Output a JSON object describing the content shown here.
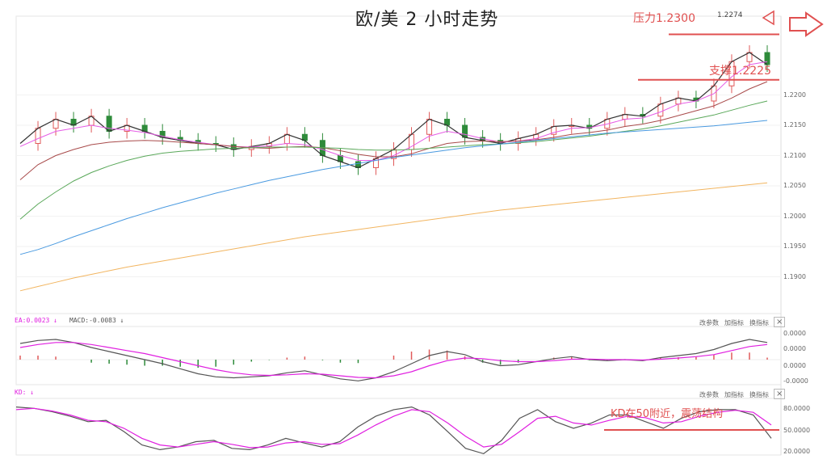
{
  "title": "欧/美 2 小时走势",
  "annotations": {
    "resistance": "压力1.2300",
    "support": "支撑1.2225",
    "kd_note": "KD在50附近，震荡结构"
  },
  "peak_label": "1.2274",
  "panel_buttons": [
    "改参数",
    "加指标",
    "换指标"
  ],
  "close_symbol": "×",
  "macd_legend": {
    "dea": "EA:0.0023 ↓",
    "macd": "MACD:-0.0083 ↓"
  },
  "kd_legend": "KD: ↓",
  "colors": {
    "up": "#e05a5a",
    "down": "#2e8b3a",
    "ma5": "#333333",
    "ma10": "#e65ce6",
    "ma20": "#c7a0a0",
    "ma30": "#a84a4a",
    "ma60": "#5aa85a",
    "ma120": "#4a9ae0",
    "ma250": "#f2b560",
    "annotation": "#e05050"
  },
  "chart_data": [
    {
      "type": "line",
      "panel": "price",
      "y_ticks": [
        "1.2200",
        "1.2150",
        "1.2100",
        "1.2050",
        "1.2000",
        "1.1950",
        "1.1900"
      ],
      "ylim": [
        1.185,
        1.233
      ],
      "series": [
        {
          "role": "price",
          "values": [
            1.212,
            1.2145,
            1.216,
            1.215,
            1.2165,
            1.214,
            1.215,
            1.214,
            1.213,
            1.2125,
            1.212,
            1.2118,
            1.211,
            1.2115,
            1.212,
            1.2135,
            1.2125,
            1.21,
            1.209,
            1.208,
            1.2095,
            1.211,
            1.2135,
            1.216,
            1.215,
            1.213,
            1.2125,
            1.212,
            1.2128,
            1.2135,
            1.2148,
            1.215,
            1.2145,
            1.216,
            1.2168,
            1.2165,
            1.2185,
            1.2195,
            1.219,
            1.2215,
            1.2255,
            1.227,
            1.225
          ]
        },
        {
          "role": "ma-short",
          "values": [
            1.2115,
            1.2128,
            1.214,
            1.2145,
            1.215,
            1.2145,
            1.2142,
            1.2138,
            1.2132,
            1.2126,
            1.2122,
            1.2118,
            1.2115,
            1.2114,
            1.2116,
            1.212,
            1.2118,
            1.211,
            1.21,
            1.2092,
            1.2092,
            1.21,
            1.2115,
            1.2132,
            1.214,
            1.2135,
            1.2128,
            1.2122,
            1.2124,
            1.2128,
            1.2138,
            1.2145,
            1.2146,
            1.2152,
            1.216,
            1.2162,
            1.2172,
            1.2185,
            1.219,
            1.2202,
            1.223,
            1.225,
            1.2255
          ]
        },
        {
          "role": "ma-mid",
          "values": [
            1.206,
            1.2085,
            1.21,
            1.211,
            1.2118,
            1.2122,
            1.2124,
            1.2125,
            1.2124,
            1.2122,
            1.212,
            1.2118,
            1.2115,
            1.2113,
            1.2112,
            1.2114,
            1.2115,
            1.2113,
            1.2108,
            1.2102,
            1.2098,
            1.2098,
            1.2103,
            1.2112,
            1.212,
            1.2123,
            1.2124,
            1.2123,
            1.2124,
            1.2126,
            1.213,
            1.2135,
            1.2138,
            1.2142,
            1.2148,
            1.2152,
            1.2158,
            1.2166,
            1.2174,
            1.2182,
            1.2195,
            1.221,
            1.2222
          ]
        },
        {
          "role": "ma-long",
          "values": [
            1.1995,
            1.202,
            1.204,
            1.2058,
            1.2072,
            1.2083,
            1.2092,
            1.2099,
            1.2104,
            1.2107,
            1.2109,
            1.2111,
            1.2112,
            1.2113,
            1.2114,
            1.2114,
            1.2114,
            1.2113,
            1.2112,
            1.211,
            1.2109,
            1.2109,
            1.211,
            1.2112,
            1.2114,
            1.2116,
            1.2118,
            1.2119,
            1.2121,
            1.2123,
            1.2126,
            1.2129,
            1.2132,
            1.2136,
            1.214,
            1.2144,
            1.2149,
            1.2155,
            1.2161,
            1.2167,
            1.2175,
            1.2183,
            1.219
          ]
        },
        {
          "role": "ma-120",
          "values": [
            1.1937,
            1.1945,
            1.1955,
            1.1966,
            1.1976,
            1.1986,
            1.1996,
            1.2005,
            1.2014,
            1.2022,
            1.203,
            1.2038,
            1.2045,
            1.2052,
            1.2059,
            1.2065,
            1.2071,
            1.2077,
            1.2082,
            1.2087,
            1.2092,
            1.2097,
            1.2101,
            1.2105,
            1.2109,
            1.2113,
            1.2116,
            1.2119,
            1.2122,
            1.2125,
            1.2128,
            1.2131,
            1.2134,
            1.2137,
            1.2139,
            1.2141,
            1.2143,
            1.2145,
            1.2147,
            1.2149,
            1.2152,
            1.2155,
            1.2158
          ]
        },
        {
          "role": "ma-250",
          "values": [
            1.1877,
            1.1884,
            1.1891,
            1.1898,
            1.1904,
            1.191,
            1.1916,
            1.1921,
            1.1926,
            1.1931,
            1.1936,
            1.1941,
            1.1946,
            1.1951,
            1.1956,
            1.1961,
            1.1966,
            1.197,
            1.1974,
            1.1978,
            1.1982,
            1.1986,
            1.199,
            1.1994,
            1.1998,
            1.2002,
            1.2006,
            1.201,
            1.2013,
            1.2016,
            1.2019,
            1.2022,
            1.2025,
            1.2028,
            1.2031,
            1.2034,
            1.2037,
            1.204,
            1.2043,
            1.2046,
            1.2049,
            1.2052,
            1.2055
          ]
        }
      ],
      "levels": [
        {
          "role": "resistance",
          "value": 1.23
        },
        {
          "role": "support",
          "value": 1.2225
        }
      ]
    },
    {
      "type": "line",
      "panel": "macd",
      "y_ticks": [
        "0.0000",
        "0.0000",
        "0.0000",
        "-0.0000"
      ],
      "series": [
        {
          "role": "dif",
          "values": [
            0.8,
            0.95,
            1.0,
            0.85,
            0.6,
            0.4,
            0.2,
            0.0,
            -0.2,
            -0.45,
            -0.7,
            -0.85,
            -0.9,
            -0.85,
            -0.8,
            -0.65,
            -0.55,
            -0.75,
            -0.95,
            -1.05,
            -0.9,
            -0.6,
            -0.2,
            0.2,
            0.4,
            0.25,
            -0.1,
            -0.3,
            -0.25,
            -0.1,
            0.05,
            0.15,
            0.0,
            -0.05,
            0.0,
            -0.05,
            0.1,
            0.2,
            0.3,
            0.5,
            0.8,
            1.0,
            0.85
          ]
        },
        {
          "role": "dea",
          "values": [
            0.6,
            0.75,
            0.85,
            0.85,
            0.75,
            0.6,
            0.45,
            0.3,
            0.1,
            -0.1,
            -0.3,
            -0.5,
            -0.65,
            -0.75,
            -0.78,
            -0.75,
            -0.7,
            -0.72,
            -0.8,
            -0.88,
            -0.9,
            -0.8,
            -0.6,
            -0.3,
            -0.05,
            0.08,
            0.05,
            -0.05,
            -0.1,
            -0.1,
            -0.05,
            0.02,
            0.03,
            0.0,
            0.0,
            -0.02,
            0.02,
            0.08,
            0.15,
            0.25,
            0.45,
            0.65,
            0.75
          ]
        },
        {
          "role": "histogram",
          "values": [
            0.2,
            0.2,
            0.15,
            0.0,
            -0.15,
            -0.2,
            -0.25,
            -0.3,
            -0.3,
            -0.35,
            -0.4,
            -0.35,
            -0.25,
            -0.1,
            -0.02,
            0.1,
            0.15,
            -0.03,
            -0.15,
            -0.17,
            0.0,
            0.2,
            0.4,
            0.5,
            0.45,
            0.17,
            -0.15,
            -0.25,
            -0.15,
            0.0,
            0.1,
            0.13,
            -0.03,
            -0.05,
            0.0,
            -0.03,
            0.08,
            0.12,
            0.15,
            0.25,
            0.35,
            0.35,
            0.1
          ]
        }
      ]
    },
    {
      "type": "line",
      "panel": "kd",
      "y_ticks": [
        "80.0000",
        "50.0000",
        "20.0000"
      ],
      "ylim": [
        20,
        100
      ],
      "series": [
        {
          "role": "k",
          "values": [
            92,
            90,
            85,
            78,
            70,
            72,
            55,
            35,
            28,
            32,
            40,
            42,
            30,
            28,
            35,
            45,
            38,
            32,
            40,
            62,
            78,
            88,
            92,
            80,
            55,
            30,
            22,
            42,
            75,
            88,
            70,
            60,
            68,
            80,
            80,
            70,
            60,
            75,
            85,
            88,
            88,
            80,
            45
          ]
        },
        {
          "role": "d",
          "values": [
            88,
            90,
            86,
            80,
            72,
            70,
            60,
            45,
            35,
            32,
            36,
            40,
            36,
            31,
            32,
            38,
            40,
            36,
            37,
            50,
            65,
            78,
            88,
            85,
            68,
            48,
            32,
            36,
            55,
            75,
            78,
            68,
            65,
            72,
            78,
            76,
            68,
            70,
            78,
            84,
            87,
            84,
            65
          ]
        }
      ],
      "levels": [
        {
          "role": "reference",
          "value": 50
        }
      ]
    }
  ]
}
